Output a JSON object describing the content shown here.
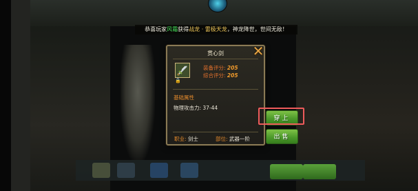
{
  "announcement": {
    "prefix": "恭喜玩家",
    "player": "风霜",
    "mid": "获得",
    "item": "战龙 · 雷极天龙",
    "suffix": "，神龙降世，世间无敌！"
  },
  "item_panel": {
    "name": "贯心剑",
    "equip_score_label": "装备评分:",
    "equip_score": "205",
    "total_score_label": "综合评分:",
    "total_score": "205",
    "section_title": "基础属性",
    "attribute": "物理攻击力: 37-44",
    "class_label": "职业:",
    "class_value": "剑士",
    "slot_label": "部位:",
    "slot_value": "武器一阶",
    "close_icon": "close-icon",
    "lock_icon": "lock-icon"
  },
  "buttons": {
    "equip": "穿上",
    "sell": "出售"
  },
  "colors": {
    "highlight": "#ee5b5b",
    "button_green": "#4d9a2b",
    "score_orange": "#f09a2c",
    "announcement_green": "#47e35c"
  }
}
